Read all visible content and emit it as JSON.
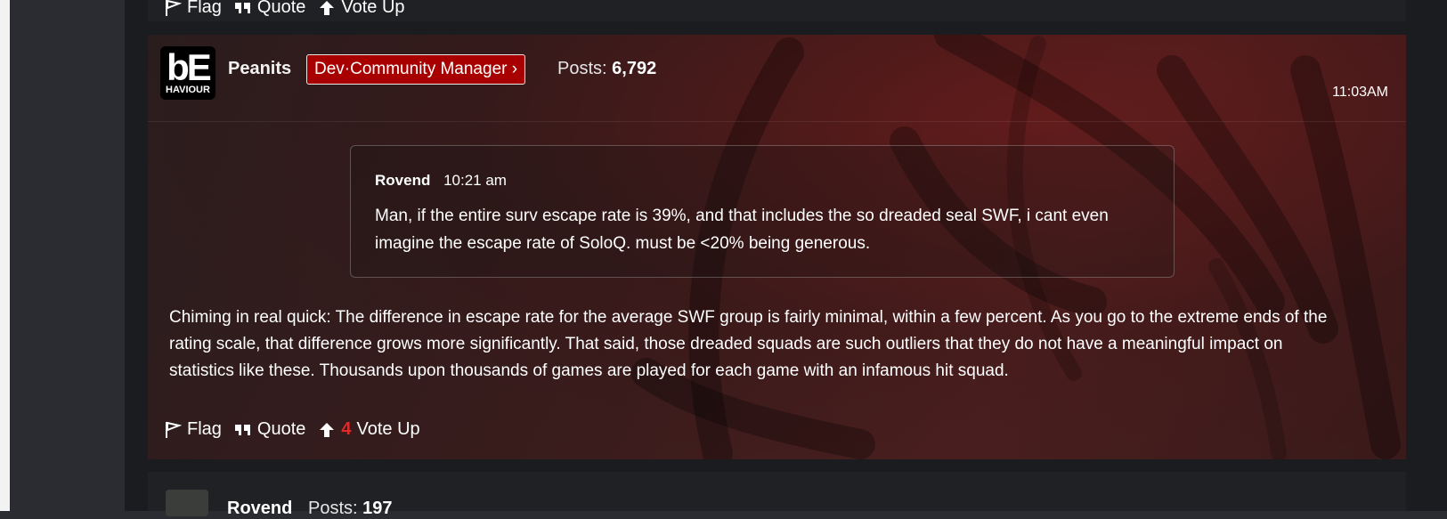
{
  "prev_post": {
    "actions": {
      "flag": "Flag",
      "quote": "Quote",
      "vote_up": "Vote Up"
    }
  },
  "dev_post": {
    "avatar": {
      "logo_top": "bE",
      "logo_bottom": "HAVIOUR"
    },
    "username": "Peanits",
    "role_badge": "Dev·Community Manager ›",
    "posts_label": "Posts:",
    "posts_count": "6,792",
    "time": "11:03AM",
    "quote": {
      "author": "Rovend",
      "time": "10:21 am",
      "text": "Man, if the entire surv escape rate is 39%, and that includes the so dreaded seal SWF, i cant even imagine the escape rate of SoloQ. must be <20% being generous."
    },
    "body": "Chiming in real quick: The difference in escape rate for the average SWF group is fairly minimal, within a few percent. As you go to the extreme ends of the rating scale, that difference grows more significantly. That said, those dreaded squads are such outliers that they do not have a meaningful impact on statistics like these. Thousands upon thousands of games are played for each game with an infamous hit squad.",
    "actions": {
      "flag": "Flag",
      "quote": "Quote",
      "vote_count": "4",
      "vote_up": "Vote Up"
    }
  },
  "next_post": {
    "username": "Rovend",
    "posts_label": "Posts:",
    "posts_count": "197"
  },
  "colors": {
    "role_badge_bg": "#a80000",
    "vote_count": "#e02a2a",
    "page_bg": "#1b1c1f"
  },
  "icons": [
    "flag-icon",
    "quote-icon",
    "arrow-up-icon"
  ]
}
